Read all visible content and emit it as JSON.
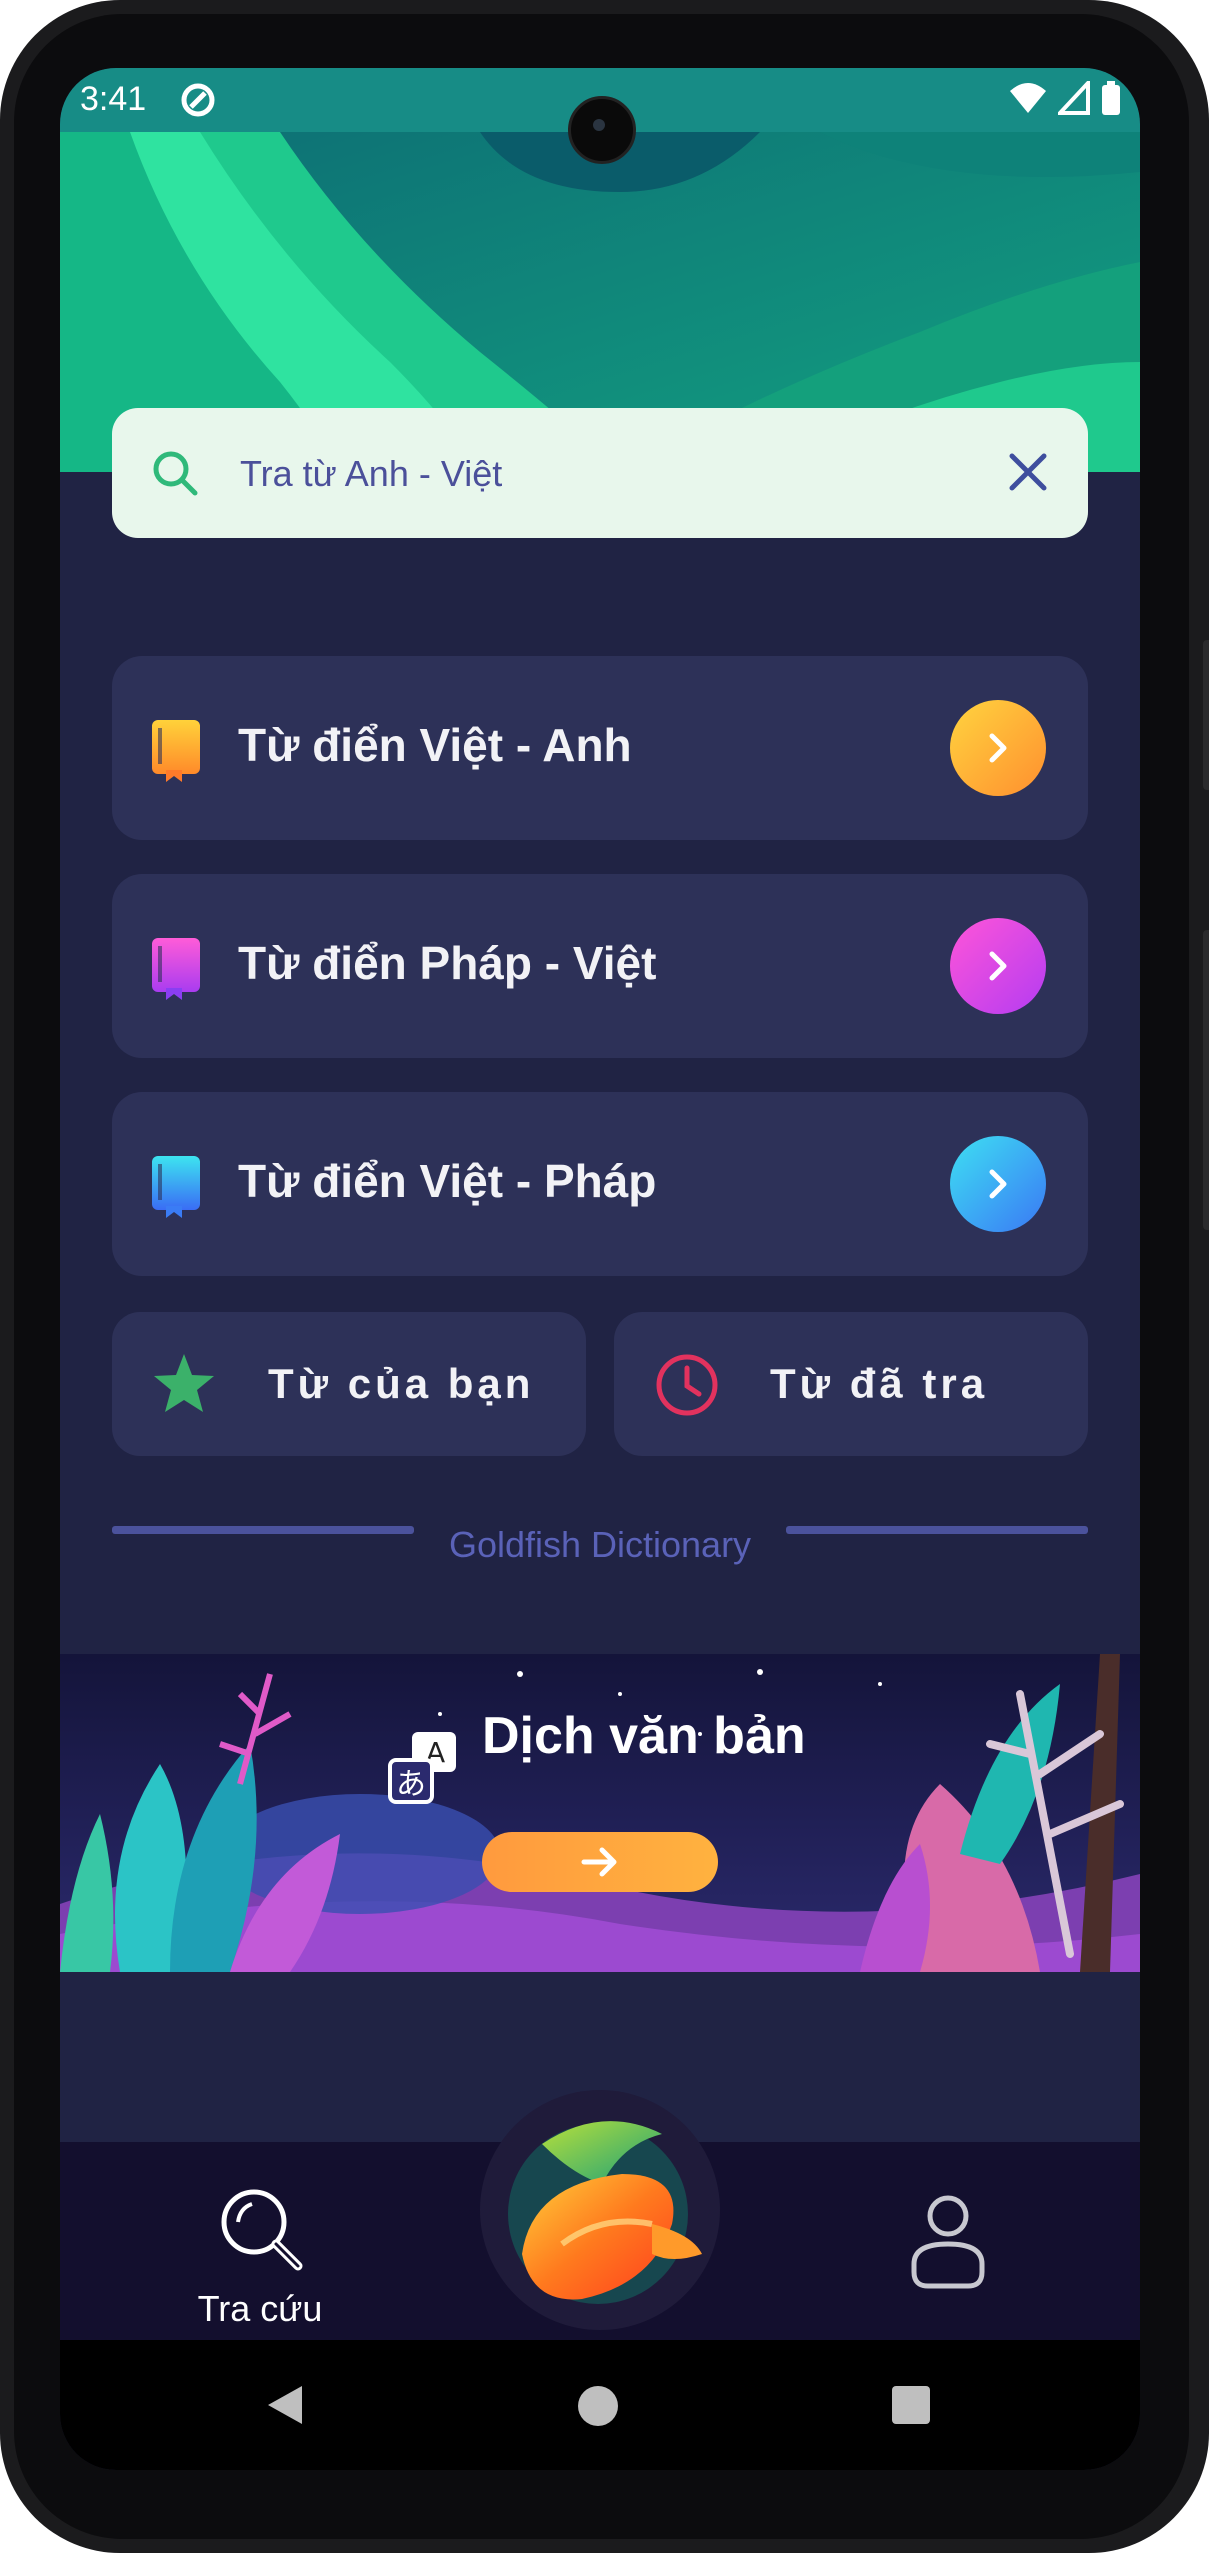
{
  "status_bar": {
    "time": "3:41"
  },
  "search": {
    "placeholder": "Tra từ Anh - Việt"
  },
  "dictionaries": [
    {
      "label": "Từ điển Việt - Anh",
      "color": "#ffb52e"
    },
    {
      "label": "Từ điển Pháp - Việt",
      "color": "#d438f0"
    },
    {
      "label": "Từ điển Việt - Pháp",
      "color": "#3a9cf5"
    }
  ],
  "shortcuts": {
    "saved_words": "Từ của bạn",
    "history": "Từ đã tra"
  },
  "divider_text": "Goldfish Dictionary",
  "banner": {
    "title": "Dịch văn bản"
  },
  "bottom_nav": {
    "lookup_label": "Tra cứu"
  },
  "colors": {
    "background": "#202344",
    "card": "#2d3158",
    "star": "#3bb16a",
    "clock": "#e2325e",
    "divider": "#4b529c"
  },
  "icons": {
    "search": "search-icon",
    "clear": "close-icon",
    "dictionary": "book-icon",
    "arrow": "chevron-right-icon",
    "saved": "star-icon",
    "history": "clock-icon",
    "translate": "translate-icon",
    "user": "user-icon"
  }
}
